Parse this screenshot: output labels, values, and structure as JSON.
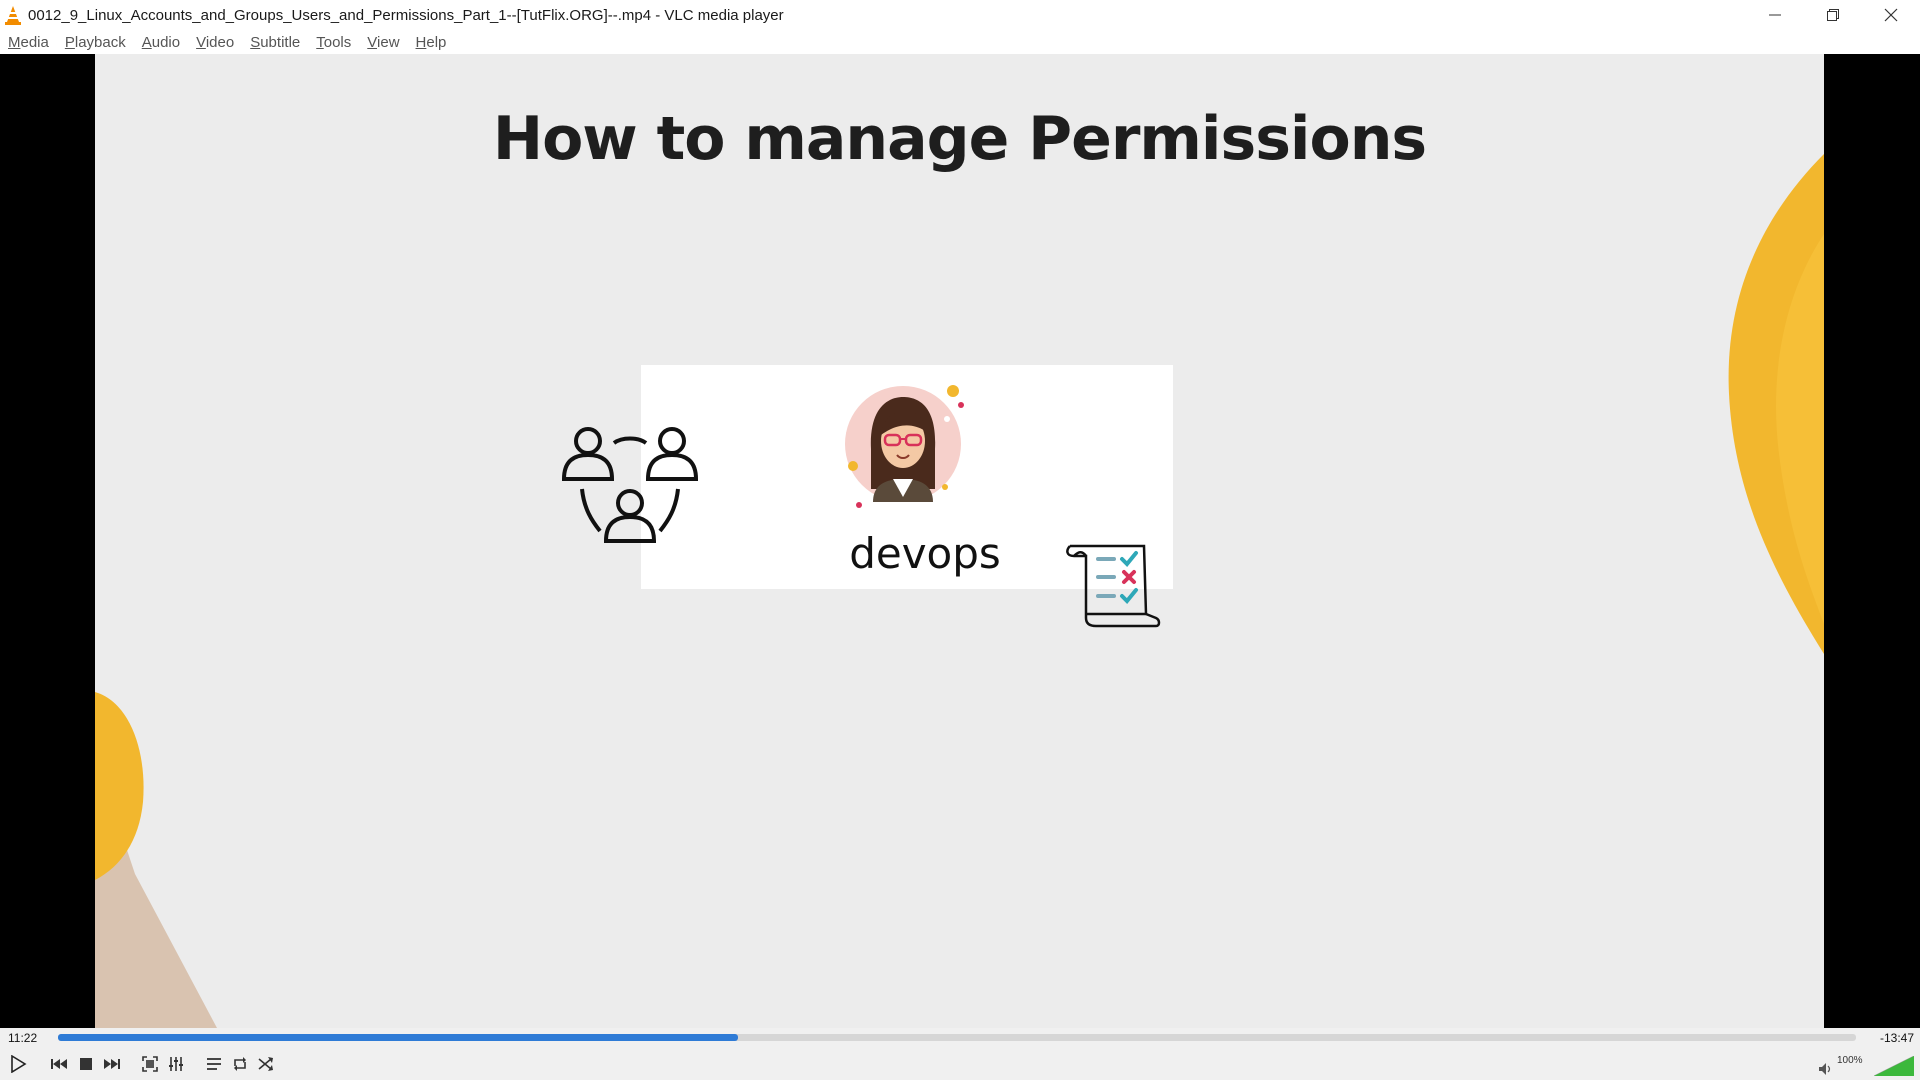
{
  "window": {
    "title": "0012_9_Linux_Accounts_and_Groups_Users_and_Permissions_Part_1--[TutFlix.ORG]--.mp4 - VLC media player"
  },
  "menu": [
    {
      "label": "Media",
      "key": "M",
      "rest": "edia"
    },
    {
      "label": "Playback",
      "key": "P",
      "rest": "layback"
    },
    {
      "label": "Audio",
      "key": "A",
      "rest": "udio"
    },
    {
      "label": "Video",
      "key": "V",
      "rest": "ideo"
    },
    {
      "label": "Subtitle",
      "key": "S",
      "rest": "ubtitle"
    },
    {
      "label": "Tools",
      "key": "T",
      "rest": "ools"
    },
    {
      "label": "View",
      "key": "V",
      "rest": "iew"
    },
    {
      "label": "Help",
      "key": "H",
      "rest": "elp"
    }
  ],
  "slide": {
    "title": "How to manage Permissions",
    "card_label": "devops"
  },
  "player": {
    "elapsed": "11:22",
    "remaining": "-13:47",
    "progress": 0.378,
    "volume_label": "100%",
    "volume": 1.0
  },
  "colors": {
    "seek_fill": "#2e7bd6",
    "volume_fill": "#3cb83c",
    "accent_yellow": "#f2b72e"
  },
  "icons": {
    "app": "vlc-cone-icon",
    "play": "play-icon",
    "prev": "previous-icon",
    "stop": "stop-icon",
    "next": "next-icon",
    "fullscreen": "fullscreen-icon",
    "extended": "extended-settings-icon",
    "playlist": "playlist-icon",
    "loop": "loop-icon",
    "random": "shuffle-icon",
    "volume": "speaker-icon"
  }
}
